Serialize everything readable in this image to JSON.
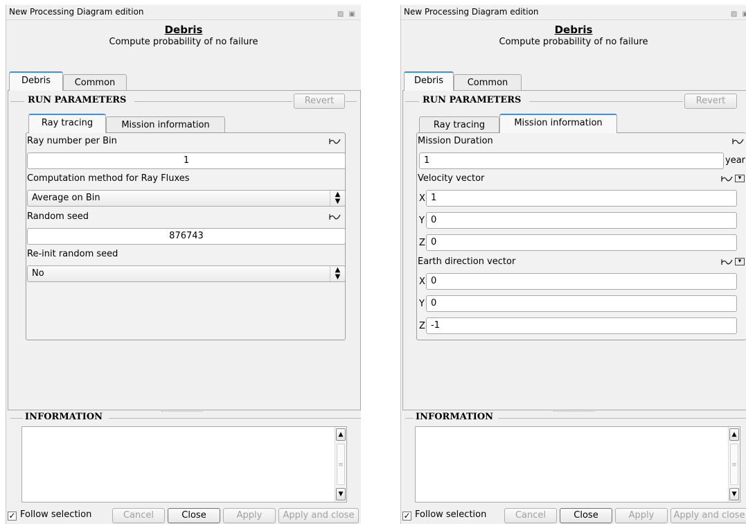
{
  "window": {
    "title": "New Processing Diagram edition",
    "icons": "▨ ▣"
  },
  "header": {
    "title": "Debris",
    "subtitle": "Compute probability of no failure"
  },
  "outer_tabs": {
    "debris": "Debris",
    "common": "Common"
  },
  "run_parameters": {
    "title": "RUN PARAMETERS",
    "revert_label": "Revert"
  },
  "inner_tabs": {
    "ray_tracing": "Ray tracing",
    "mission_information": "Mission information"
  },
  "ray_tracing": {
    "ray_number_label": "Ray number per Bin",
    "ray_number_value": "1",
    "computation_method_label": "Computation method for Ray Fluxes",
    "computation_method_value": "Average on Bin",
    "random_seed_label": "Random seed",
    "random_seed_value": "876743",
    "reinit_label": "Re-init random seed",
    "reinit_value": "No"
  },
  "mission": {
    "duration_label": "Mission Duration",
    "duration_value": "1",
    "duration_unit": "year",
    "velocity_label": "Velocity vector",
    "velocity": {
      "x": "1",
      "y": "0",
      "z": "0"
    },
    "earth_label": "Earth direction vector",
    "earth": {
      "x": "0",
      "y": "0",
      "z": "-1"
    },
    "axis_x": "X",
    "axis_y": "Y",
    "axis_z": "Z"
  },
  "information": {
    "title": "INFORMATION"
  },
  "footer": {
    "follow_selection": "Follow selection",
    "cancel": "Cancel",
    "close": "Close",
    "apply": "Apply",
    "apply_and_close": "Apply and close"
  },
  "colors": {
    "tab_accent": "#3c8ee6",
    "panel_bg": "#f0f0f0"
  }
}
